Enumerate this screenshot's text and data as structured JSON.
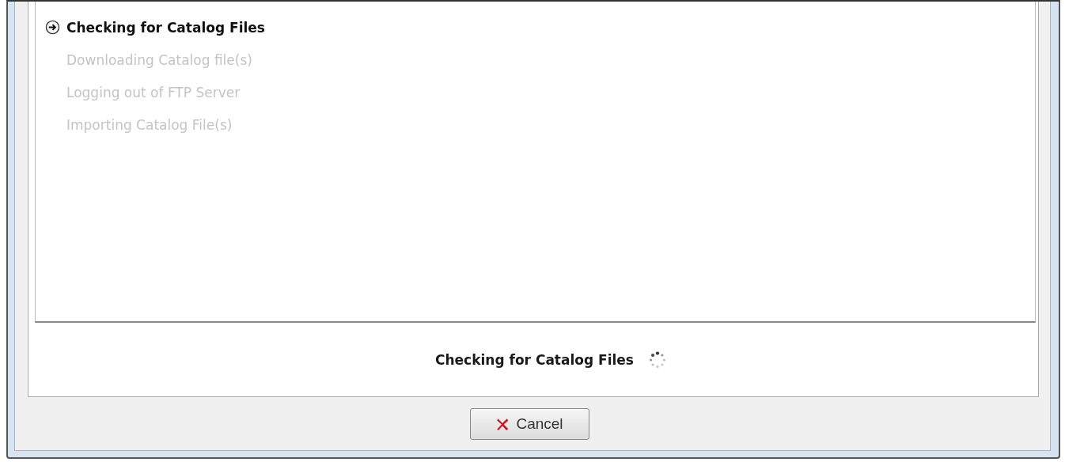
{
  "steps": [
    {
      "label": "Checking for Catalog Files",
      "current": true
    },
    {
      "label": "Downloading Catalog file(s)",
      "current": false
    },
    {
      "label": "Logging out of FTP Server",
      "current": false
    },
    {
      "label": "Importing Catalog File(s)",
      "current": false
    }
  ],
  "status_message": "Checking for Catalog Files",
  "buttons": [
    {
      "label": "Cancel",
      "kind": "cancel"
    }
  ]
}
